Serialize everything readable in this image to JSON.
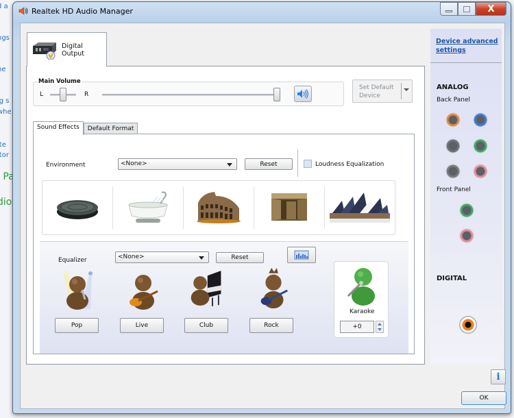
{
  "background_window": {
    "fragments": [
      "d a",
      "ngs",
      "he",
      "ig s",
      "whe",
      "ite",
      "itor",
      "l Pa",
      "dio"
    ]
  },
  "window": {
    "title": "Realtek HD Audio Manager",
    "icon": "speaker-icon",
    "controls": {
      "minimize": "minimize",
      "maximize": "maximize",
      "close": "X"
    }
  },
  "device_tab": {
    "label": "Digital Output",
    "icon": "digital-output-device-icon"
  },
  "main_volume": {
    "caption": "Main Volume",
    "balance_left": "L",
    "balance_right": "R",
    "balance_position": 0.5,
    "volume_level": 1.0,
    "mute_icon": "speaker-volume-icon"
  },
  "set_default": {
    "label_line1": "Set Default",
    "label_line2": "Device",
    "enabled": false
  },
  "tabs": [
    {
      "label": "Sound Effects",
      "active": true
    },
    {
      "label": "Default Format",
      "active": false
    }
  ],
  "sound_effects": {
    "environment": {
      "label": "Environment",
      "selected": "<None>",
      "reset_label": "Reset",
      "loudness_label": "Loudness Equalization",
      "loudness_checked": false,
      "presets": [
        {
          "name": "manhole-cover",
          "icon": "stone-disk-icon"
        },
        {
          "name": "bathroom",
          "icon": "bathtub-icon"
        },
        {
          "name": "colosseum",
          "icon": "colosseum-icon"
        },
        {
          "name": "stone-room",
          "icon": "stone-corridor-icon"
        },
        {
          "name": "opera-house",
          "icon": "opera-house-icon"
        }
      ]
    },
    "equalizer": {
      "label": "Equalizer",
      "selected": "<None>",
      "reset_label": "Reset",
      "graphic_eq_icon": "graphic-eq-icon",
      "presets": [
        {
          "label": "Pop",
          "icon": "singer-pop-icon"
        },
        {
          "label": "Live",
          "icon": "guitarist-live-icon"
        },
        {
          "label": "Club",
          "icon": "pianist-club-icon"
        },
        {
          "label": "Rock",
          "icon": "guitarist-rock-icon"
        }
      ]
    },
    "karaoke": {
      "label": "Karaoke",
      "value": "+0",
      "icon": "karaoke-singer-icon"
    }
  },
  "sidebar": {
    "link": "Device advanced settings",
    "analog_header": "ANALOG",
    "back_panel_label": "Back Panel",
    "back_panel_jacks": [
      "#e58a3c",
      "#3f7fd9",
      "#6f7278",
      "#3fa868",
      "#7a7c80",
      "#e6889e"
    ],
    "front_panel_label": "Front Panel",
    "front_panel_jacks": [
      "#3fa868",
      "#e6889e"
    ],
    "digital_header": "DIGITAL",
    "digital_jack_color": "#f07e18"
  },
  "footer": {
    "info_icon": "info-icon",
    "ok_label": "OK"
  }
}
